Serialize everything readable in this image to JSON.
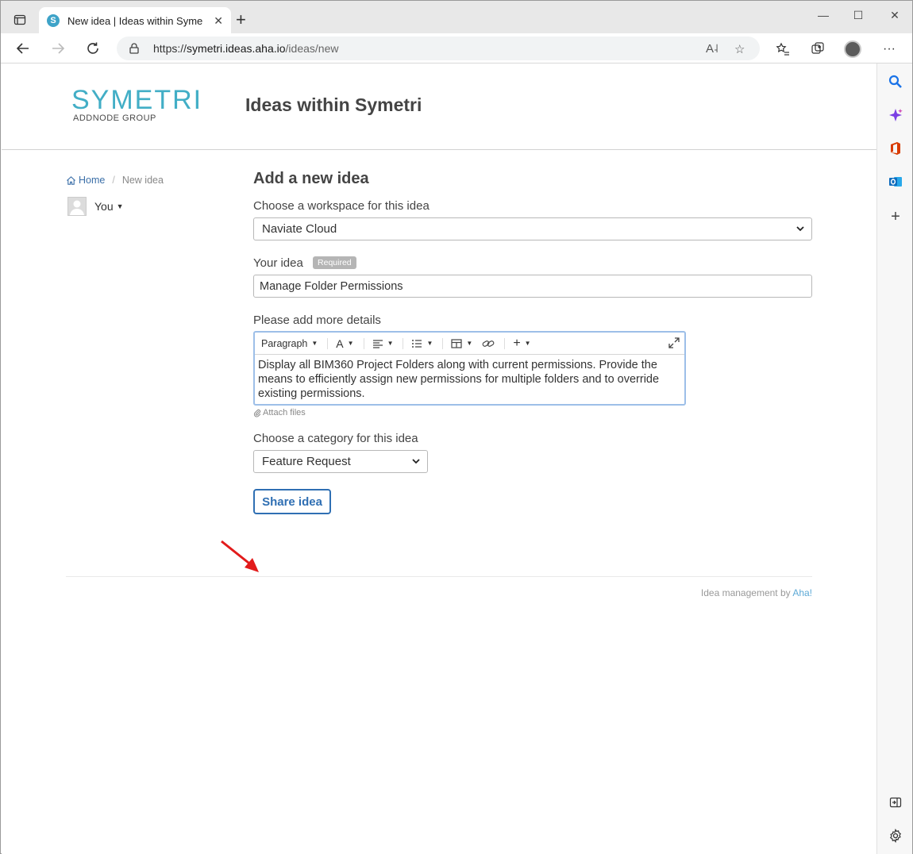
{
  "browser": {
    "tab_title": "New idea | Ideas within Symetri",
    "tab_favicon_letter": "S",
    "url_scheme": "https://",
    "url_host": "symetri.ideas.aha.io",
    "url_path": "/ideas/new",
    "icons": [
      "tab-actions-icon",
      "new-tab-icon",
      "minimize-icon",
      "maximize-icon",
      "close-window-icon",
      "back-icon",
      "forward-icon",
      "refresh-icon",
      "lock-icon",
      "read-aloud-icon",
      "add-favorite-icon",
      "favorites-icon",
      "collections-icon",
      "profile-avatar",
      "more-icon"
    ]
  },
  "edge_sidebar": {
    "icons": [
      "search-icon",
      "copilot-icon",
      "office-icon",
      "outlook-icon",
      "add-icon",
      "hide-sidebar-icon",
      "settings-icon"
    ],
    "colors": {
      "search": "#1a73e8",
      "copilot": "#7b3fe4",
      "office": "#d83b01",
      "outlook": "#0f6cbd"
    }
  },
  "header": {
    "logo_main": "SYMETRI",
    "logo_sub": "ADDNODE GROUP",
    "site_title": "Ideas within Symetri",
    "logo_color": "#42aec6"
  },
  "breadcrumb": {
    "home": "Home",
    "current": "New idea"
  },
  "user": {
    "label": "You"
  },
  "form": {
    "title": "Add a new idea",
    "workspace_label": "Choose a workspace for this idea",
    "workspace_value": "Naviate Cloud",
    "idea_label": "Your idea",
    "required_badge": "Required",
    "idea_value": "Manage Folder Permissions",
    "details_label": "Please add more details",
    "editor_toolbar": {
      "paragraph": "Paragraph",
      "font": "A"
    },
    "details_text": "Display all BIM360 Project Folders along with current permissions. Provide the means to efficiently assign new permissions for multiple folders and to override existing permissions.",
    "attach_label": "Attach files",
    "category_label": "Choose a category for this idea",
    "category_value": "Feature Request",
    "submit_label": "Share idea",
    "accent_color": "#2f6fb3"
  },
  "footer": {
    "text": "Idea management by",
    "link": "Aha!"
  },
  "annotation": {
    "arrow_color": "#e21b1b",
    "points_to": "share-idea-button"
  }
}
